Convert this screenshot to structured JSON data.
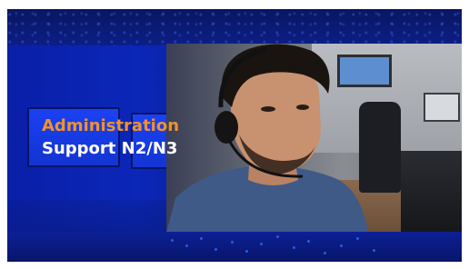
{
  "banner": {
    "title_line1": "Administration",
    "title_line2": "Support N2/N3"
  },
  "colors": {
    "background_blue": "#0b1f86",
    "accent_orange": "#f0922b",
    "text_white": "#ffffff"
  },
  "image": {
    "subject": "headset-support-agent-photo"
  }
}
